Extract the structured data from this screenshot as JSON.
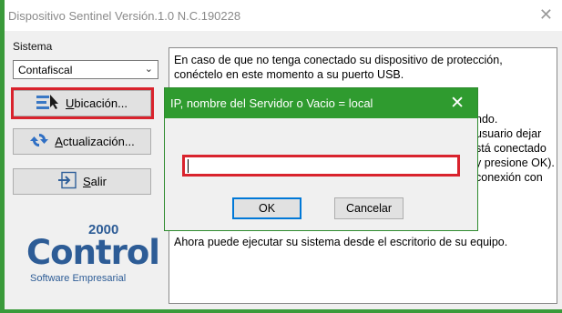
{
  "window": {
    "title": "Dispositivo Sentinel Versión.1.0 N.C.190228",
    "close_glyph": "✕"
  },
  "sidebar": {
    "sistema_label": "Sistema",
    "combo_value": "Contafiscal",
    "buttons": [
      {
        "prefix": "",
        "underline": "U",
        "rest": "bicación...",
        "icon": "location-cursor-icon"
      },
      {
        "prefix": "",
        "underline": "A",
        "rest": "ctualización...",
        "icon": "refresh-icon"
      },
      {
        "prefix": "",
        "underline": "S",
        "rest": "alir",
        "icon": "exit-icon"
      }
    ],
    "logo": {
      "year": "2000",
      "name": "Control",
      "subtitle": "Software Empresarial"
    }
  },
  "info": {
    "lines": [
      "En caso de que no tenga conectado su dispositivo de protección,",
      "conéctelo en este momento a su puerto USB.",
      "",
      "",
      "ndo.",
      "usuario dejar",
      "stá conectado",
      "y presione OK).",
      "conexión con",
      "",
      "",
      "Ahora puede ejecutar su sistema desde el escritorio de su equipo."
    ]
  },
  "dialog": {
    "title": "IP, nombre del Servidor o Vacio = local",
    "close_glyph": "✕",
    "input_value": "",
    "ok_label": "OK",
    "cancel_label": "Cancelar"
  },
  "colors": {
    "accent_green": "#2f9b2f",
    "highlight_red": "#d9232d",
    "logo_blue": "#2d5c96"
  }
}
